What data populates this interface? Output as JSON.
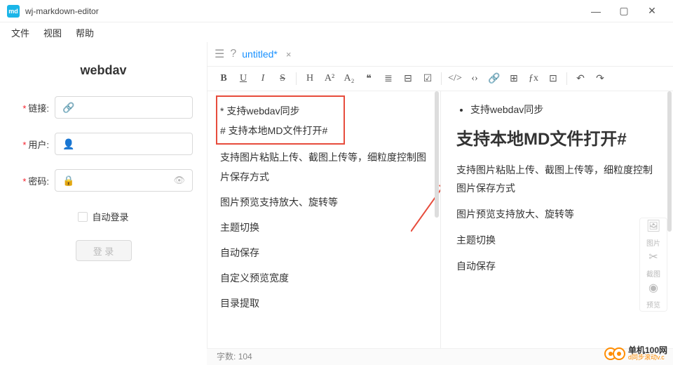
{
  "window": {
    "icon": "md",
    "title": "wj-markdown-editor"
  },
  "menu": {
    "file": "文件",
    "view": "视图",
    "help": "帮助"
  },
  "sidebar": {
    "title": "webdav",
    "link": {
      "label": "链接:"
    },
    "user": {
      "label": "用户:"
    },
    "password": {
      "label": "密码:"
    },
    "auto_login": "自动登录",
    "login": "登 录"
  },
  "tab": {
    "name": "untitled*",
    "help": "?"
  },
  "toolbar": {
    "bold": "B",
    "underline": "U",
    "italic": "I",
    "strike": "S",
    "heading": "H",
    "sup": "A²",
    "sub": "A₂",
    "quote": "❝",
    "ul": "≣",
    "ol": "⊟",
    "check": "☑",
    "code": "</>",
    "inlinecode": "‹›",
    "link": "🔗",
    "table": "⊞",
    "formula": "ƒx",
    "image": "⊡",
    "undo": "↶",
    "redo": "↷"
  },
  "editor": {
    "lines": [
      "* 支持webdav同步",
      "# 支持本地MD文件打开#",
      "支持图片粘贴上传、截图上传等，细粒度控制图片保存方式",
      "图片预览支持放大、旋转等",
      "主题切换",
      "自动保存",
      "自定义预览宽度",
      "目录提取"
    ]
  },
  "preview": {
    "bullet": "支持webdav同步",
    "h1": "支持本地MD文件打开#",
    "p1": "支持图片粘贴上传、截图上传等，细粒度控制图片保存方式",
    "p2": "图片预览支持放大、旋转等",
    "p3": "主题切换",
    "p4": "自动保存"
  },
  "float_tools": {
    "image": "图片",
    "screenshot": "截图",
    "preview": "预览"
  },
  "status": {
    "chars_label": "字数:",
    "chars": "104"
  },
  "watermark": {
    "text": "单机100网",
    "sub": "d同步滚动v.c"
  }
}
